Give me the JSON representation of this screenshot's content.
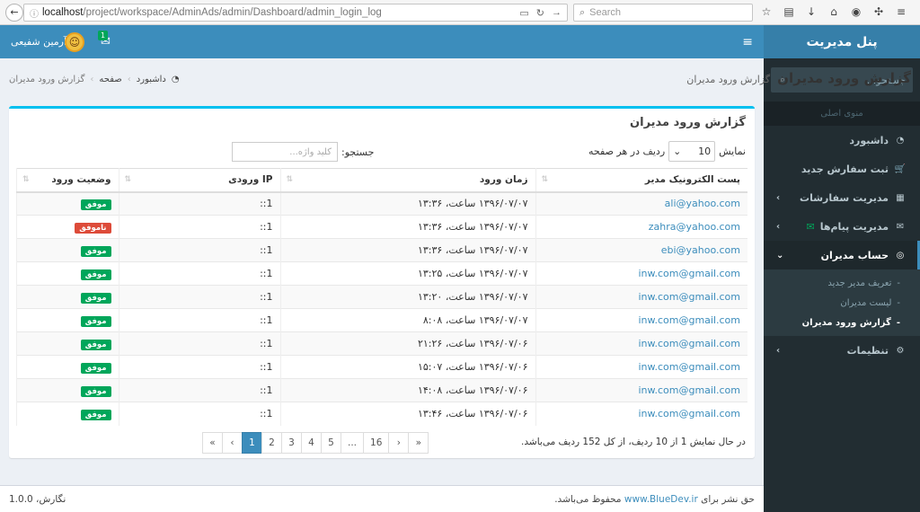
{
  "browser": {
    "url_host": "localhost",
    "url_path": "/project/workspace/AdminAds/admin/Dashboard/admin_login_log",
    "search_placeholder": "Search"
  },
  "sidebar": {
    "logo": "پنل مدیریت",
    "search_placeholder": "جستجو...",
    "header": "منوی اصلی",
    "items": [
      {
        "label": "داشبورد",
        "icon": "dashboard-icon"
      },
      {
        "label": "ثبت سفارش جدید",
        "icon": "cart-icon"
      },
      {
        "label": "مدیریت سفارشات",
        "icon": "cubes-icon"
      },
      {
        "label": "مدیریت پیام‌ها",
        "icon": "envelope-icon"
      },
      {
        "label": "حساب مدیران",
        "icon": "user-circle-icon"
      },
      {
        "label": "تنظیمات",
        "icon": "gear-icon"
      }
    ],
    "sub_items": [
      {
        "label": "تعریف مدیر جدید"
      },
      {
        "label": "لیست مدیران"
      },
      {
        "label": "گزارش ورود مدیران"
      }
    ]
  },
  "header": {
    "user_name": "آرمین شفیعی",
    "mail_count": "1"
  },
  "page": {
    "title": "گزارش ورود مدیران",
    "subtitle": "گزارش ورود مدیران",
    "breadcrumb": [
      "داشبورد",
      "صفحه",
      "گزارش ورود مدیران"
    ]
  },
  "box": {
    "title": "گزارش ورود مدیران",
    "show_label": "نمایش",
    "rows_label": "ردیف در هر صفحه",
    "page_length": "10",
    "search_label": "جستجو:",
    "search_placeholder": "کلید واژه..."
  },
  "table": {
    "columns": [
      "پست الکترونیک مدیر",
      "زمان ورود",
      "IP ورودی",
      "وضعیت ورود"
    ],
    "rows": [
      {
        "email": "ali@yahoo.com",
        "time": "۱۳۹۶/۰۷/۰۷ ساعت، ۱۳:۳۶",
        "ip": "::1",
        "status": "موفق",
        "ok": true
      },
      {
        "email": "zahra@yahoo.com",
        "time": "۱۳۹۶/۰۷/۰۷ ساعت، ۱۳:۳۶",
        "ip": "::1",
        "status": "ناموفق",
        "ok": false
      },
      {
        "email": "ebi@yahoo.com",
        "time": "۱۳۹۶/۰۷/۰۷ ساعت، ۱۳:۳۶",
        "ip": "::1",
        "status": "موفق",
        "ok": true
      },
      {
        "email": "inw.com@gmail.com",
        "time": "۱۳۹۶/۰۷/۰۷ ساعت، ۱۳:۲۵",
        "ip": "::1",
        "status": "موفق",
        "ok": true
      },
      {
        "email": "inw.com@gmail.com",
        "time": "۱۳۹۶/۰۷/۰۷ ساعت، ۱۳:۲۰",
        "ip": "::1",
        "status": "موفق",
        "ok": true
      },
      {
        "email": "inw.com@gmail.com",
        "time": "۱۳۹۶/۰۷/۰۷ ساعت، ۸:۰۸",
        "ip": "::1",
        "status": "موفق",
        "ok": true
      },
      {
        "email": "inw.com@gmail.com",
        "time": "۱۳۹۶/۰۷/۰۶ ساعت، ۲۱:۲۶",
        "ip": "::1",
        "status": "موفق",
        "ok": true
      },
      {
        "email": "inw.com@gmail.com",
        "time": "۱۳۹۶/۰۷/۰۶ ساعت، ۱۵:۰۷",
        "ip": "::1",
        "status": "موفق",
        "ok": true
      },
      {
        "email": "inw.com@gmail.com",
        "time": "۱۳۹۶/۰۷/۰۶ ساعت، ۱۴:۰۸",
        "ip": "::1",
        "status": "موفق",
        "ok": true
      },
      {
        "email": "inw.com@gmail.com",
        "time": "۱۳۹۶/۰۷/۰۶ ساعت، ۱۳:۴۶",
        "ip": "::1",
        "status": "موفق",
        "ok": true
      }
    ]
  },
  "pagination": {
    "info": "در حال نمایش 1 از 10 ردیف، از کل 152 ردیف می‌باشد.",
    "pages": [
      "«",
      "‹",
      "1",
      "2",
      "3",
      "4",
      "5",
      "...",
      "16",
      "›",
      "»"
    ],
    "active": "1"
  },
  "footer": {
    "copy_prefix": "حق نشر برای",
    "copy_link": "www.BlueDev.ir",
    "copy_suffix": "محفوظ می‌باشد.",
    "version": "نگارش، 1.0.0"
  },
  "colors": {
    "success": "#00a65a",
    "danger": "#dd4b39",
    "primary": "#3c8dbc"
  }
}
